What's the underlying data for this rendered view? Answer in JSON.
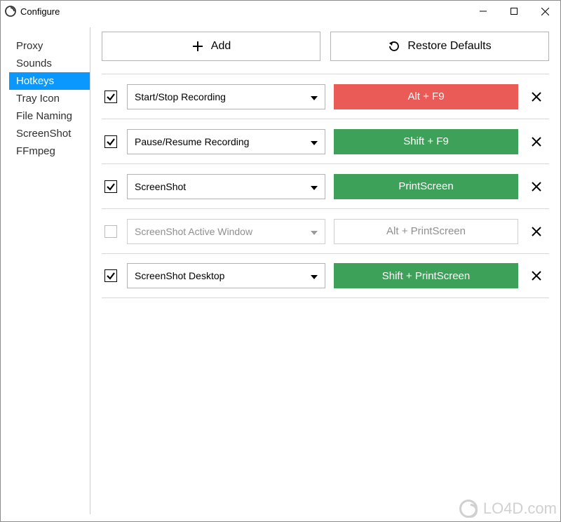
{
  "window": {
    "title": "Configure"
  },
  "sidebar": {
    "items": [
      {
        "label": "Proxy",
        "active": false
      },
      {
        "label": "Sounds",
        "active": false
      },
      {
        "label": "Hotkeys",
        "active": true
      },
      {
        "label": "Tray Icon",
        "active": false
      },
      {
        "label": "File Naming",
        "active": false
      },
      {
        "label": "ScreenShot",
        "active": false
      },
      {
        "label": "FFmpeg",
        "active": false
      }
    ]
  },
  "actions": {
    "add_label": "Add",
    "restore_label": "Restore Defaults"
  },
  "colors": {
    "red": "#ea5a56",
    "green": "#3da159"
  },
  "hotkeys": [
    {
      "enabled": true,
      "action": "Start/Stop Recording",
      "key": "Alt + F9",
      "color": "red"
    },
    {
      "enabled": true,
      "action": "Pause/Resume Recording",
      "key": "Shift + F9",
      "color": "green"
    },
    {
      "enabled": true,
      "action": "ScreenShot",
      "key": "PrintScreen",
      "color": "green"
    },
    {
      "enabled": false,
      "action": "ScreenShot Active Window",
      "key": "Alt + PrintScreen",
      "color": "disabled"
    },
    {
      "enabled": true,
      "action": "ScreenShot Desktop",
      "key": "Shift + PrintScreen",
      "color": "green"
    }
  ],
  "watermark": {
    "text": "LO4D.com"
  }
}
